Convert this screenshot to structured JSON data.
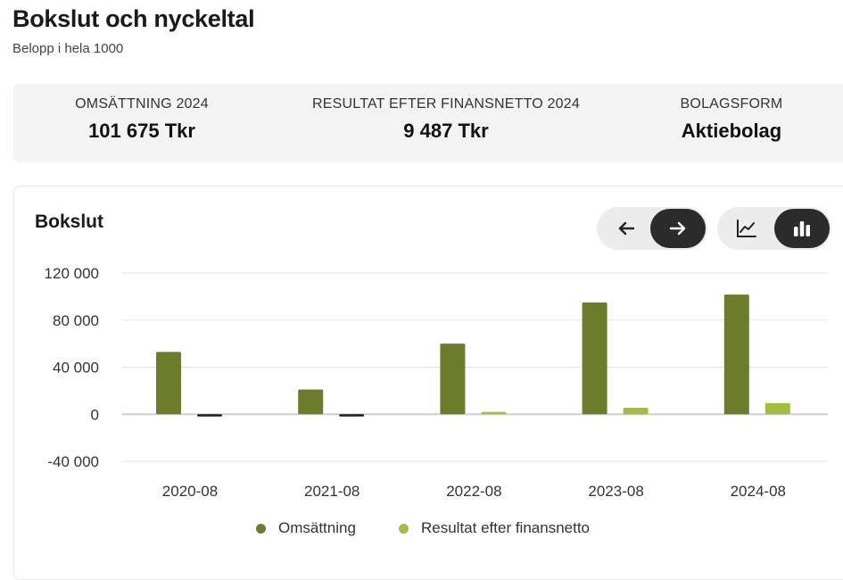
{
  "header": {
    "title": "Bokslut och nyckeltal",
    "subtitle": "Belopp i hela 1000"
  },
  "kpis": [
    {
      "label": "OMSÄTTNING 2024",
      "value": "101 675 Tkr"
    },
    {
      "label": "RESULTAT EFTER FINANSNETTO 2024",
      "value": "9 487 Tkr"
    },
    {
      "label": "BOLAGSFORM",
      "value": "Aktiebolag"
    }
  ],
  "card": {
    "title": "Bokslut",
    "nav_icons": [
      "arrow-left-icon",
      "arrow-right-icon"
    ],
    "view_icons": [
      "line-chart-icon",
      "bar-chart-icon"
    ],
    "active_nav": "arrow-right-icon",
    "active_view": "bar-chart-icon"
  },
  "colors": {
    "omsattning": "#6b7d2a",
    "resultat": "#a3be3c",
    "negative": "#1a1a1a",
    "grid": "#e3e3e3",
    "axis_text": "#333333",
    "toggle_active": "#2b2b2b"
  },
  "chart_data": {
    "type": "bar",
    "categories": [
      "2020-08",
      "2021-08",
      "2022-08",
      "2023-08",
      "2024-08"
    ],
    "series": [
      {
        "name": "Omsättning",
        "values": [
          53000,
          21000,
          60000,
          95000,
          101675
        ]
      },
      {
        "name": "Resultat efter finansnetto",
        "values": [
          -1500,
          -1500,
          2000,
          5500,
          9487
        ]
      }
    ],
    "yticks": [
      120000,
      80000,
      40000,
      0,
      -40000
    ],
    "ytick_labels": [
      "120 000",
      "80 000",
      "40 000",
      "0",
      "-40 000"
    ],
    "ylim": [
      -40000,
      120000
    ],
    "grid": true,
    "legend": "bottom-center",
    "xlabel": "",
    "ylabel": ""
  }
}
